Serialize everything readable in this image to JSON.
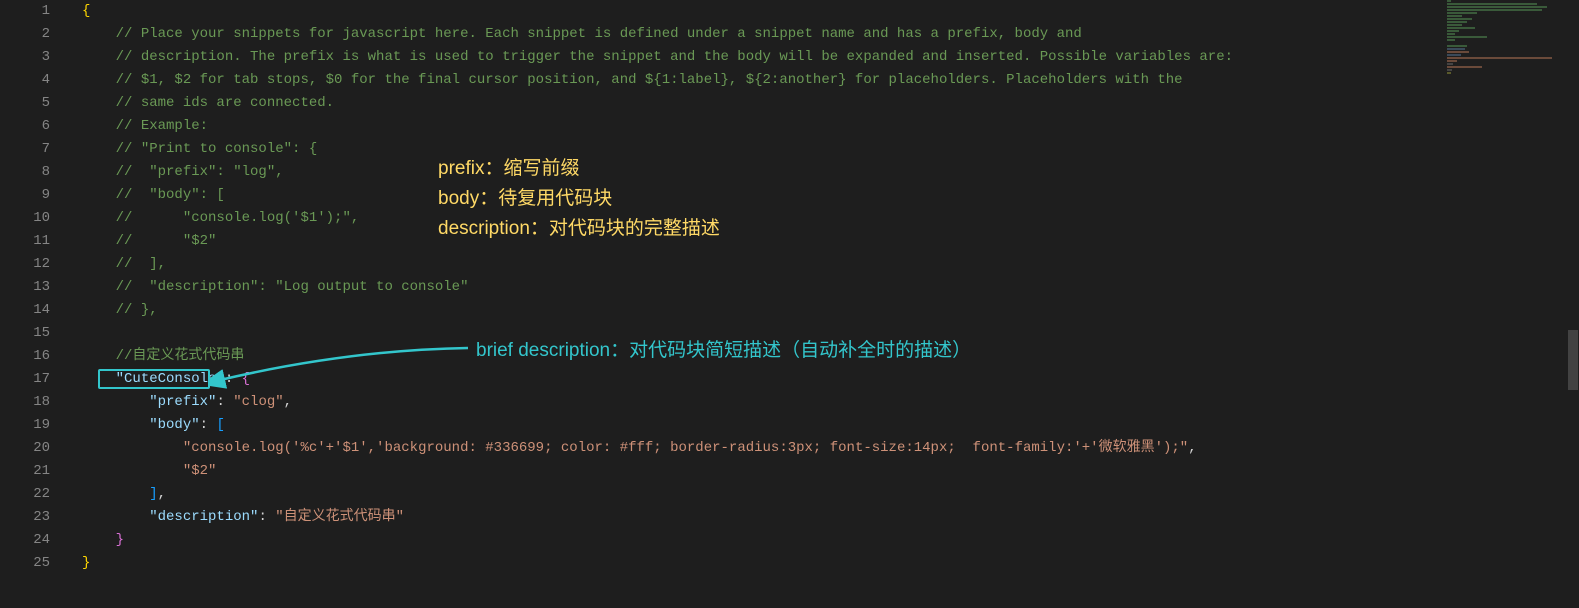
{
  "lineCount": 25,
  "code": {
    "l1": "{",
    "l2_comment": "// Place your snippets for javascript here. Each snippet is defined under a snippet name and has a prefix, body and",
    "l3_comment": "// description. The prefix is what is used to trigger the snippet and the body will be expanded and inserted. Possible variables are:",
    "l4_comment": "// $1, $2 for tab stops, $0 for the final cursor position, and ${1:label}, ${2:another} for placeholders. Placeholders with the",
    "l5_comment": "// same ids are connected.",
    "l6_comment": "// Example:",
    "l7_comment": "// \"Print to console\": {",
    "l8_comment": "//  \"prefix\": \"log\",",
    "l9_comment": "//  \"body\": [",
    "l10_comment": "//      \"console.log('$1');\",",
    "l11_comment": "//      \"$2\"",
    "l12_comment": "//  ],",
    "l13_comment": "//  \"description\": \"Log output to console\"",
    "l14_comment": "// },",
    "l16_comment": "//自定义花式代码串",
    "l17_key": "\"CuteConsole\"",
    "l18_key": "\"prefix\"",
    "l18_val": "\"clog\"",
    "l19_key": "\"body\"",
    "l20_val": "\"console.log('%c'+'$1','background: #336699; color: #fff; border-radius:3px; font-size:14px;  font-family:'+'微软雅黑');\"",
    "l21_val": "\"$2\"",
    "l23_key": "\"description\"",
    "l23_val": "\"自定义花式代码串\"",
    "l25": "}"
  },
  "annotations": {
    "prefix": "prefix：缩写前缀",
    "body": "body：待复用代码块",
    "description": "description：对代码块的完整描述",
    "brief": "brief description：对代码块简短描述（自动补全时的描述）"
  },
  "colors": {
    "bg": "#1e1e1e",
    "comment": "#6a9955",
    "key": "#9cdcfe",
    "string": "#ce9178",
    "anno_yellow": "#ffd966",
    "anno_cyan": "#33c6cc"
  }
}
